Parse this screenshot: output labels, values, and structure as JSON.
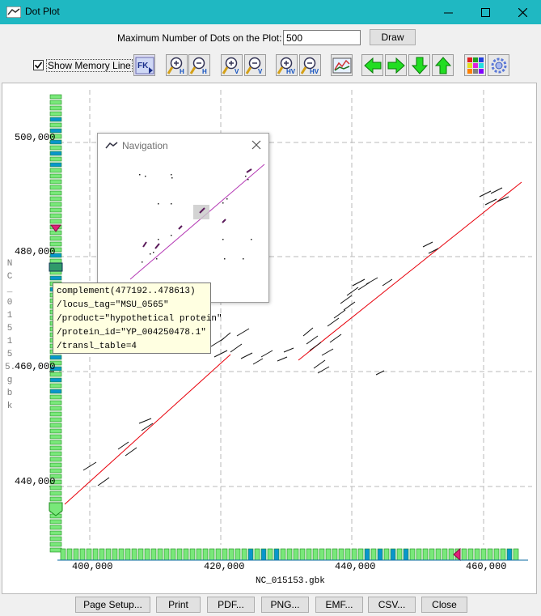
{
  "window": {
    "title": "Dot Plot",
    "accent": "#1fb8c2"
  },
  "controls": {
    "max_dots_label": "Maximum Number of Dots on the Plot:",
    "max_dots_value": "500",
    "draw_label": "Draw",
    "show_memory_line_label": "Show Memory Line",
    "show_memory_line_checked": true,
    "fk_label": "FK"
  },
  "toolbar_icons": [
    "fk-icon",
    "zoom-in-h-icon",
    "zoom-out-h-icon",
    "zoom-in-v-icon",
    "zoom-out-v-icon",
    "zoom-in-hv-icon",
    "zoom-out-hv-icon",
    "memory-graph-icon",
    "arrow-left-icon",
    "arrow-right-icon",
    "arrow-down-icon",
    "arrow-up-icon",
    "color-grid-icon",
    "settings-gear-icon"
  ],
  "toolbar_badges": {
    "h": "H",
    "v": "V",
    "hv": "HV"
  },
  "plot": {
    "y_ticks": [
      "500,000",
      "480,000",
      "460,000",
      "440,000"
    ],
    "x_ticks": [
      "400,000",
      "420,000",
      "440,000",
      "460,000"
    ],
    "x_axis_label": "NC_015153.gbk",
    "y_axis_label": "NC_015155.gbk",
    "diagonal_color": "#e8000b",
    "gene_color": "#79e87a",
    "gene_blue": "#0a95cc"
  },
  "navigation": {
    "title": "Navigation"
  },
  "tooltip": {
    "lines": [
      "complement(477192..478613)",
      "/locus_tag=\"MSU_0565\"",
      "/product=\"hypothetical protein\"",
      "/protein_id=\"YP_004250478.1\"",
      "/transl_table=4"
    ]
  },
  "bottom_buttons": {
    "page_setup": "Page Setup...",
    "print": "Print",
    "pdf": "PDF...",
    "png": "PNG...",
    "emf": "EMF...",
    "csv": "CSV...",
    "close": "Close"
  }
}
